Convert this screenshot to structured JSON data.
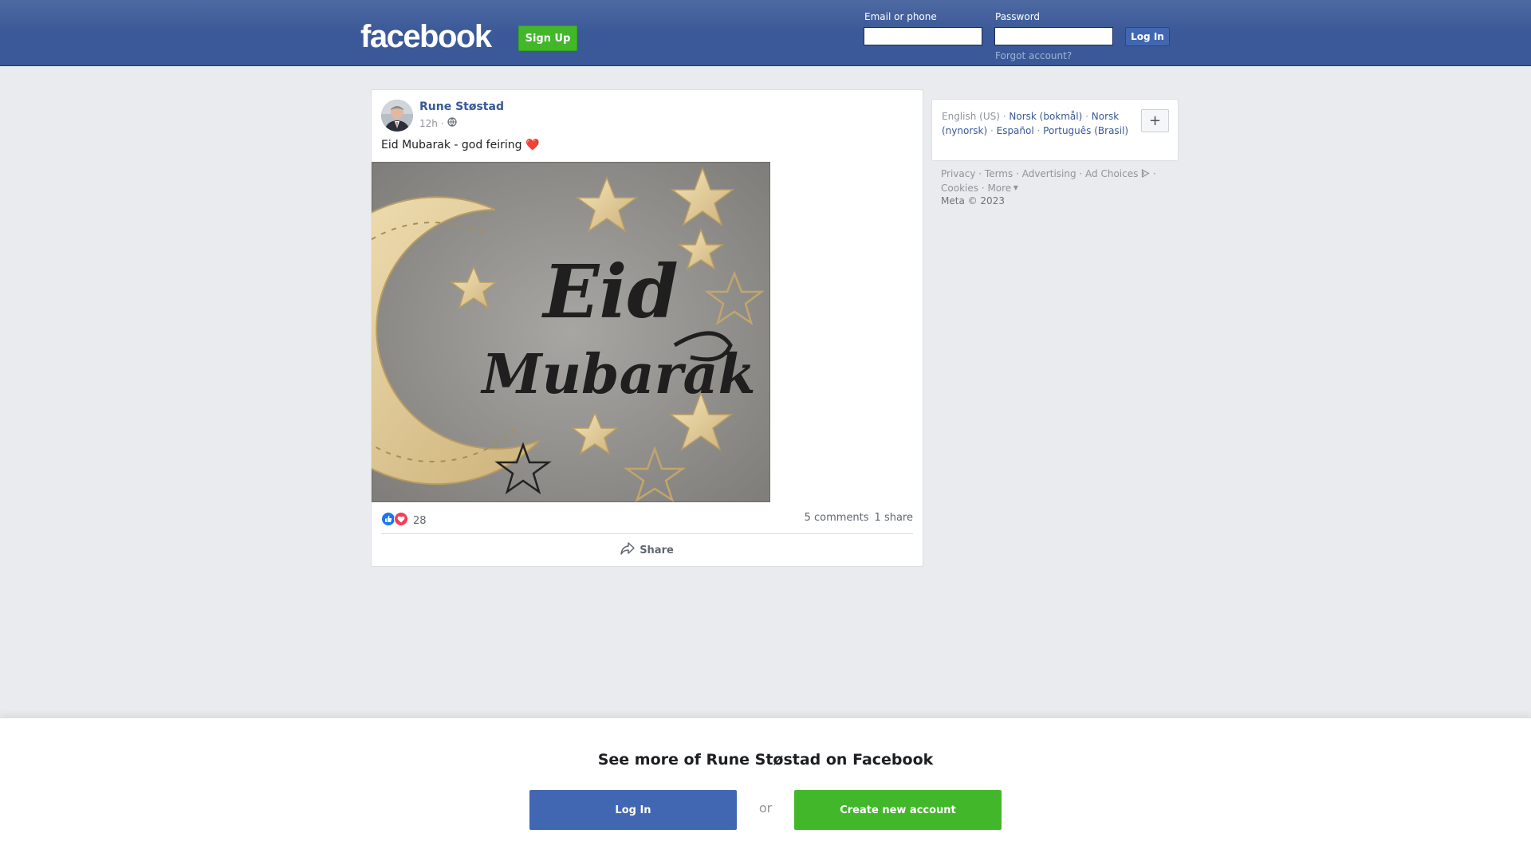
{
  "header": {
    "logo_text": "facebook",
    "signup_label": "Sign Up",
    "email_label": "Email or phone",
    "email_value": "",
    "password_label": "Password",
    "password_value": "",
    "login_label": "Log In",
    "forgot_label": "Forgot account?"
  },
  "post": {
    "author": "Rune Støstad",
    "time": "12h",
    "separator": "·",
    "privacy_icon": "globe-icon",
    "text": "Eid Mubarak - god feiring ❤️",
    "image_text_line1": "Eid",
    "image_text_line2": "Mubarak",
    "reaction_icons": [
      "like-icon",
      "love-icon"
    ],
    "reaction_count": "28",
    "comments": "5 comments",
    "shares": "1 share",
    "share_label": "Share"
  },
  "sidebar": {
    "languages": [
      {
        "label": "English (US)",
        "active": true
      },
      {
        "label": "Norsk (bokmål)",
        "active": false
      },
      {
        "label": "Norsk (nynorsk)",
        "active": false
      },
      {
        "label": "Español",
        "active": false
      },
      {
        "label": "Português (Brasil)",
        "active": false
      }
    ],
    "more_languages_label": "+",
    "footer_links": [
      "Privacy",
      "Terms",
      "Advertising",
      "Ad Choices",
      "Cookies",
      "More"
    ],
    "copyright": "Meta © 2023"
  },
  "banner": {
    "title": "See more of Rune Støstad on Facebook",
    "login_label": "Log In",
    "or_label": "or",
    "create_label": "Create new account"
  },
  "colors": {
    "header_bg": "#3b5998",
    "link": "#385898",
    "green": "#42b72a",
    "primary": "#4267b2"
  }
}
